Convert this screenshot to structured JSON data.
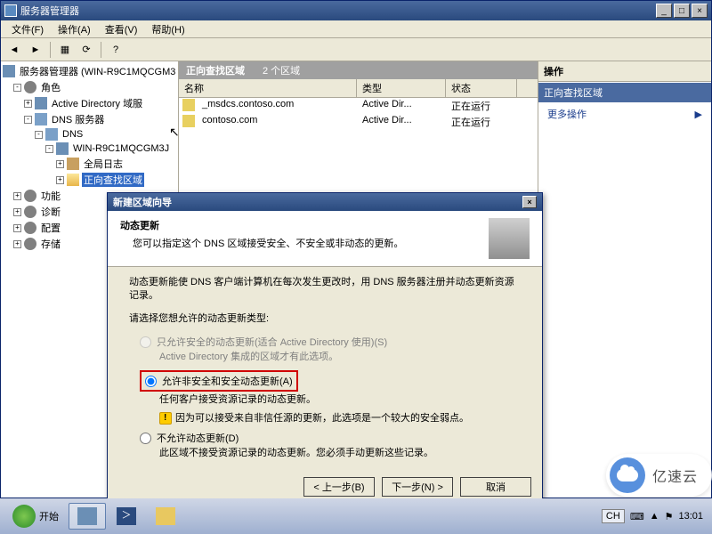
{
  "window": {
    "title": "服务器管理器",
    "minimize": "_",
    "maximize": "□",
    "close": "×"
  },
  "menu": {
    "file": "文件(F)",
    "action": "操作(A)",
    "view": "查看(V)",
    "help": "帮助(H)"
  },
  "tree": {
    "root": "服务器管理器 (WIN-R9C1MQCGM3",
    "roles": "角色",
    "ad": "Active Directory 域服",
    "dnsServer": "DNS 服务器",
    "dns": "DNS",
    "host": "WIN-R9C1MQCGM3J",
    "globalLog": "全局日志",
    "fwdZone": "正向查找区域",
    "features": "功能",
    "diagnostics": "诊断",
    "config": "配置",
    "storage": "存储"
  },
  "center": {
    "title": "正向查找区域",
    "count": "2 个区域",
    "cols": {
      "name": "名称",
      "type": "类型",
      "status": "状态"
    },
    "rows": [
      {
        "name": "_msdcs.contoso.com",
        "type": "Active Dir...",
        "status": "正在运行"
      },
      {
        "name": "contoso.com",
        "type": "Active Dir...",
        "status": "正在运行"
      }
    ]
  },
  "actions": {
    "header": "操作",
    "section": "正向查找区域",
    "more": "更多操作"
  },
  "dialog": {
    "title": "新建区域向导",
    "heading": "动态更新",
    "subheading": "您可以指定这个 DNS 区域接受安全、不安全或非动态的更新。",
    "para1": "动态更新能使 DNS 客户端计算机在每次发生更改时，用 DNS 服务器注册并动态更新资源记录。",
    "para2": "请选择您想允许的动态更新类型:",
    "opt1": "只允许安全的动态更新(适合 Active Directory 使用)(S)",
    "opt1sub": "Active Directory 集成的区域才有此选项。",
    "opt2": "允许非安全和安全动态更新(A)",
    "opt2sub": "任何客户接受资源记录的动态更新。",
    "opt2warn": "因为可以接受来自非信任源的更新，此选项是一个较大的安全弱点。",
    "opt3": "不允许动态更新(D)",
    "opt3sub": "此区域不接受资源记录的动态更新。您必须手动更新这些记录。",
    "back": "< 上一步(B)",
    "next": "下一步(N) >",
    "cancel": "取消"
  },
  "taskbar": {
    "start": "开始",
    "lang": "CH",
    "ime": "⌨",
    "time": "13:01"
  },
  "watermark": "亿速云"
}
